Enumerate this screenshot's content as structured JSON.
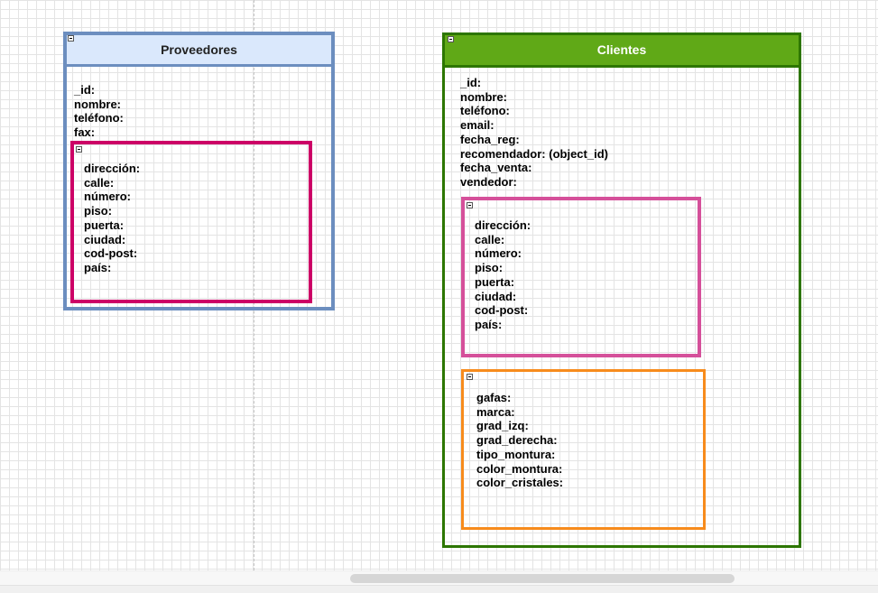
{
  "proveedores": {
    "title": "Proveedores",
    "fields": [
      "_id:",
      "nombre:",
      "teléfono:",
      "fax:"
    ],
    "direccion": [
      "dirección:",
      "calle:",
      "número:",
      "piso:",
      "puerta:",
      "ciudad:",
      "cod-post:",
      "país:"
    ]
  },
  "clientes": {
    "title": "Clientes",
    "fields": [
      "_id:",
      "nombre:",
      "teléfono:",
      "email:",
      "fecha_reg:",
      "recomendador: (object_id)",
      "fecha_venta:",
      "vendedor:"
    ],
    "direccion": [
      "dirección:",
      "calle:",
      "número:",
      "piso:",
      "puerta:",
      "ciudad:",
      "cod-post:",
      "país:"
    ],
    "gafas": [
      "gafas:",
      "marca:",
      "grad_izq:",
      "grad_derecha:",
      "tipo_montura:",
      "color_montura:",
      "color_cristales:"
    ]
  },
  "colors": {
    "proveedores_border": "#6c8ebf",
    "proveedores_fill": "#dae8fc",
    "proveedores_direccion_border": "#cc0066",
    "clientes_border": "#2d7600",
    "clientes_fill": "#60a917",
    "clientes_direccion_border": "#d5509a",
    "clientes_gafas_border": "#f78b1c"
  },
  "icons": [
    "collapse-icon"
  ]
}
